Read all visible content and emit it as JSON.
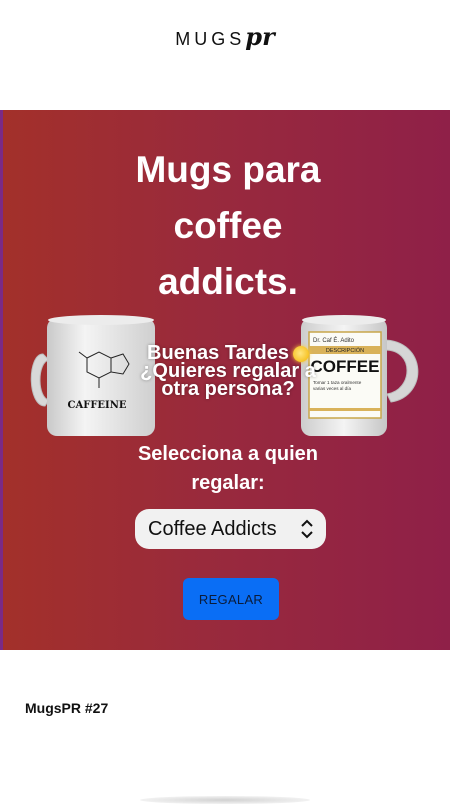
{
  "brand": {
    "logo_text": "MUGS",
    "logo_script": "pr"
  },
  "hero": {
    "headline_lines": [
      "Mugs para",
      "coffee",
      "addicts."
    ],
    "greeting_lines": [
      "Buenas Tardes",
      "¿Quieres regalar a",
      "otra persona?"
    ],
    "select_label_lines": [
      "Selecciona a quien",
      "regalar:"
    ],
    "select_value": "Coffee Addicts",
    "button_label": "REGALAR",
    "mug_left": {
      "title": "CAFFEINE"
    },
    "mug_right": {
      "line1": "Dr. Caf É. Adito",
      "line2": "DESCRIPCIÓN",
      "title": "COFFEE",
      "line3": "Tomar 1 taza oralmente",
      "line4": "varias veces al día"
    }
  },
  "footer": {
    "title": "MugsPR #27"
  },
  "colors": {
    "hero_start": "#a3302a",
    "hero_end": "#8f2048",
    "button": "#0a6ef5"
  }
}
